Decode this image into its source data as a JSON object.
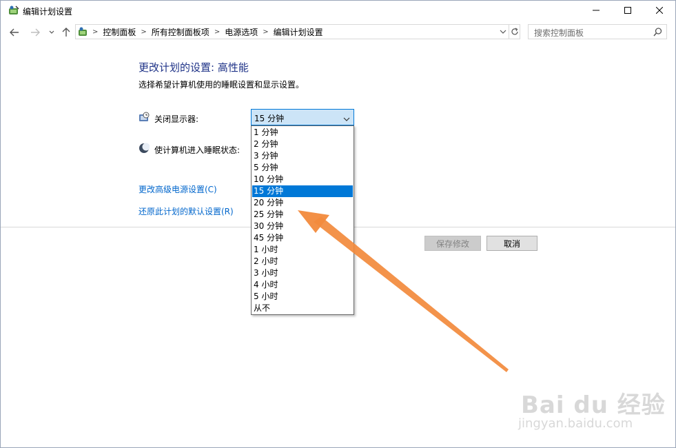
{
  "window": {
    "title": "编辑计划设置"
  },
  "nav": {
    "breadcrumbs": [
      "控制面板",
      "所有控制面板项",
      "电源选项",
      "编辑计划设置"
    ],
    "search_placeholder": "搜索控制面板"
  },
  "content": {
    "title": "更改计划的设置: 高性能",
    "subtitle": "选择希望计算机使用的睡眠设置和显示设置。",
    "display_label": "关闭显示器:",
    "sleep_label": "使计算机进入睡眠状态:",
    "display_selected": "15 分钟",
    "advanced_link": "更改高级电源设置(C)",
    "restore_link": "还原此计划的默认设置(R)"
  },
  "dropdown": {
    "options": [
      "1 分钟",
      "2 分钟",
      "3 分钟",
      "5 分钟",
      "10 分钟",
      "15 分钟",
      "20 分钟",
      "25 分钟",
      "30 分钟",
      "45 分钟",
      "1 小时",
      "2 小时",
      "3 小时",
      "4 小时",
      "5 小时",
      "从不"
    ],
    "selected_index": 5
  },
  "buttons": {
    "save": "保存修改",
    "cancel": "取消"
  },
  "watermark": {
    "logo": "Bai du 经验",
    "url": "jingyan.baidu.com"
  },
  "colors": {
    "accent": "#0078d7",
    "title_blue": "#1e3287",
    "link_blue": "#0066cc",
    "annotation_arrow": "#f28a3c"
  }
}
